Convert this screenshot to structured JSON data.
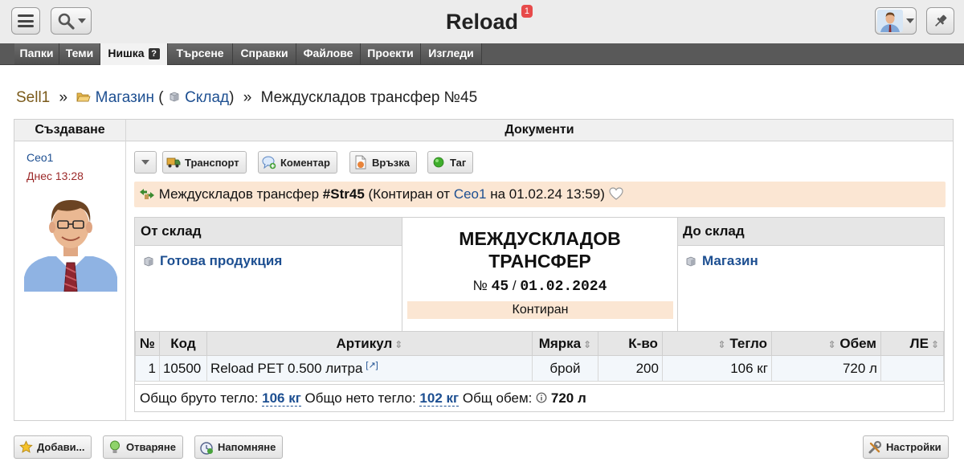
{
  "header": {
    "title": "Reload",
    "notification_count": "1"
  },
  "tabs": [
    {
      "label": "Папки"
    },
    {
      "label": "Теми"
    },
    {
      "label": "Нишка",
      "help": "?"
    },
    {
      "label": "Търсене"
    },
    {
      "label": "Справки"
    },
    {
      "label": "Файлове"
    },
    {
      "label": "Проекти"
    },
    {
      "label": "Изгледи"
    }
  ],
  "breadcrumb": {
    "home": "Sell1",
    "separator": "»",
    "folder": "Магазин",
    "open_paren": "(",
    "store": "Склад",
    "close_paren": ")",
    "current": "Междускладов трансфер №45"
  },
  "left_column": {
    "header": "Създаване",
    "author": "Сео1",
    "time": "Днес 13:28"
  },
  "right_column": {
    "header": "Документи"
  },
  "toolbar": {
    "transport": "Транспорт",
    "comment": "Коментар",
    "link": "Връзка",
    "tag": "Таг"
  },
  "status_line": {
    "prefix": "Междускладов трансфер",
    "code": "#Str45",
    "posted_text": "(Контиран от",
    "user": "Сео1",
    "date_text": "на 01.02.24 13:59)"
  },
  "document": {
    "from_label": "От склад",
    "from_value": "Готова продукция",
    "to_label": "До склад",
    "to_value": "Магазин",
    "title_line1": "МЕЖДУСКЛАДОВ",
    "title_line2": "ТРАНСФЕР",
    "number_prefix": "№",
    "number": "45",
    "number_sep": "/",
    "date": "01.02.2024",
    "state": "Контиран"
  },
  "items_table": {
    "columns": [
      "№",
      "Код",
      "Артикул",
      "Мярка",
      "К-во",
      "Тегло",
      "Обем",
      "ЛЕ"
    ],
    "rows": [
      {
        "no": "1",
        "code": "10500",
        "article": "Reload PET 0.500 литра",
        "ext": "[↗]",
        "unit": "брой",
        "qty": "200",
        "weight": "106 кг",
        "volume": "720 л",
        "le": ""
      }
    ]
  },
  "totals": {
    "gross_label": "Общо бруто тегло:",
    "gross_value": "106 кг",
    "net_label": "Общо нето тегло:",
    "net_value": "102 кг",
    "volume_label": "Общ обем:",
    "volume_value": "720 л"
  },
  "bottom_buttons": {
    "add": "Добави...",
    "open": "Отваряне",
    "remind": "Напомняне",
    "settings": "Настройки"
  },
  "colors": {
    "link": "#1d4f91",
    "highlight": "#fbe6d3",
    "tabbar": "#595959",
    "notification": "#e74a4a"
  }
}
